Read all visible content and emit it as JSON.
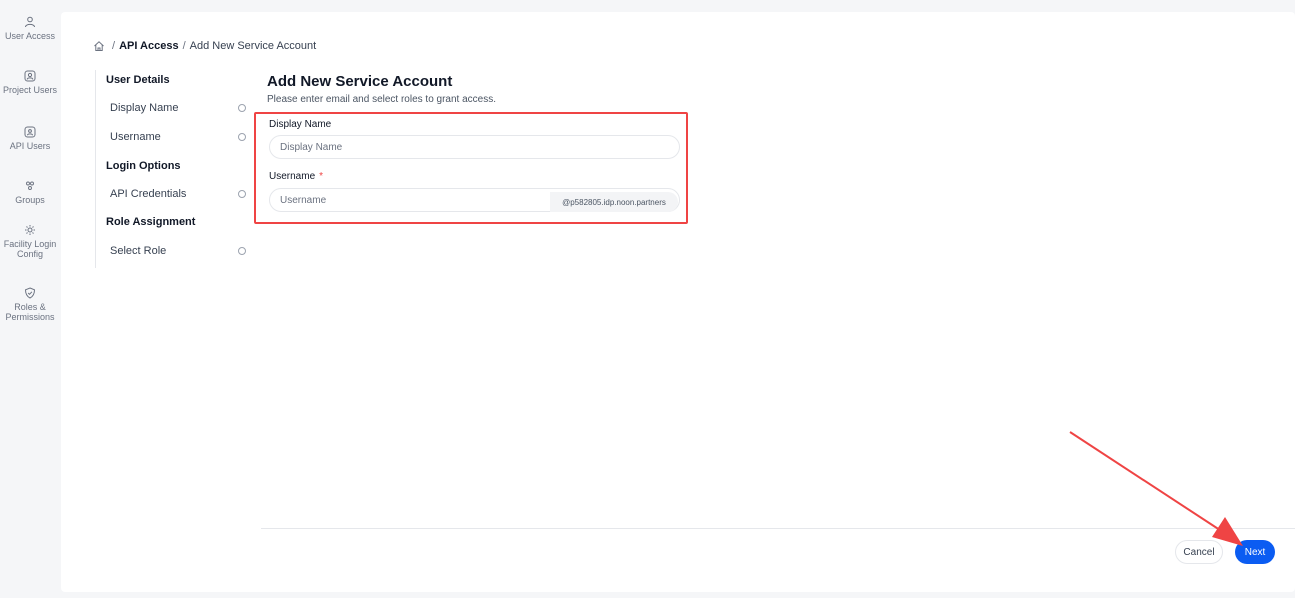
{
  "rail": {
    "items": [
      {
        "label": "User Access",
        "icon": "user-icon"
      },
      {
        "label": "Project Users",
        "icon": "project-users-icon"
      },
      {
        "label": "API Users",
        "icon": "api-users-icon"
      },
      {
        "label": "Groups",
        "icon": "groups-icon"
      },
      {
        "label": "Facility Login Config",
        "icon": "facility-config-icon"
      },
      {
        "label": "Roles & Permissions",
        "icon": "shield-icon"
      }
    ]
  },
  "breadcrumb": {
    "sep": "/",
    "parent": "API Access",
    "current": "Add New Service Account"
  },
  "steps": {
    "groups": [
      {
        "title": "User Details",
        "items": [
          "Display Name",
          "Username"
        ]
      },
      {
        "title": "Login Options",
        "items": [
          "API Credentials"
        ]
      },
      {
        "title": "Role Assignment",
        "items": [
          "Select Role"
        ]
      }
    ]
  },
  "form": {
    "title": "Add New Service Account",
    "subtitle": "Please enter email and select roles to grant access.",
    "display_name": {
      "label": "Display Name",
      "placeholder": "Display Name"
    },
    "username": {
      "label": "Username",
      "required": "*",
      "placeholder": "Username",
      "suffix": "@p582805.idp.noon.partners"
    }
  },
  "footer": {
    "cancel_label": "Cancel",
    "next_label": "Next"
  },
  "colors": {
    "accent": "#0b5cf2",
    "highlight": "#ef4444"
  }
}
